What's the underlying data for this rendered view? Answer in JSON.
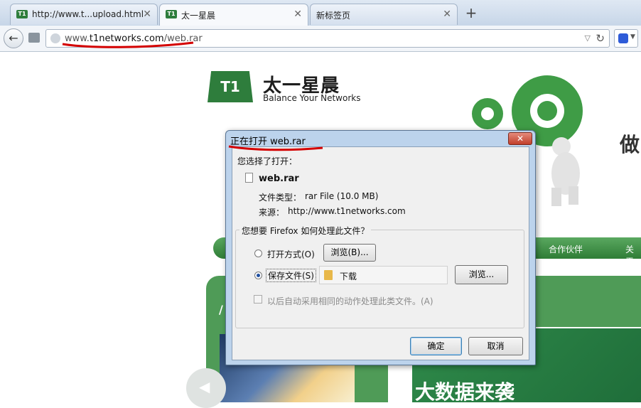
{
  "browser": {
    "tabs": [
      {
        "title": "http://www.t...upload.html",
        "active": false
      },
      {
        "title": "太一星晨",
        "active": true
      },
      {
        "title": "新标签页",
        "active": false
      }
    ],
    "tab_close_symbol": "✕",
    "new_tab_symbol": "+",
    "url": {
      "prefix": "www.",
      "domain": "t1networks.com",
      "path": "/web.rar"
    },
    "icons": {
      "back": "back-arrow-icon",
      "tab_groups": "tab-groups-icon",
      "site": "globe-icon",
      "reload": "reload-icon",
      "search_engine": "baidu-paw-icon"
    }
  },
  "page": {
    "logo_mark": "T1",
    "logo_cn": "太一星晨",
    "logo_en": "Balance Your Networks",
    "hero_text": "做",
    "nav_links": [
      "合作伙伴",
      "关于"
    ],
    "panel_heading_fragment": "/",
    "banner_text": "大数据来袭",
    "brand_green": "#2e7d3c"
  },
  "dialog": {
    "title": "正在打开 web.rar",
    "close_symbol": "✕",
    "chose_label": "您选择了打开：",
    "file_name": "web.rar",
    "file_type_label": "文件类型：",
    "file_type_value": "rar File (10.0 MB)",
    "source_label": "来源：",
    "source_value": "http://www.t1networks.com",
    "question": "您想要 Firefox 如何处理此文件？",
    "open_with_label": "打开方式(O)",
    "open_with_selected": false,
    "browse_button_1": "浏览(B)...",
    "save_file_label": "保存文件(S)",
    "save_file_selected": true,
    "save_folder": "下载",
    "browse_button_2": "浏览...",
    "auto_label": "以后自动采用相同的动作处理此类文件。(A)",
    "auto_checked": false,
    "ok_button": "确定",
    "cancel_button": "取消"
  }
}
